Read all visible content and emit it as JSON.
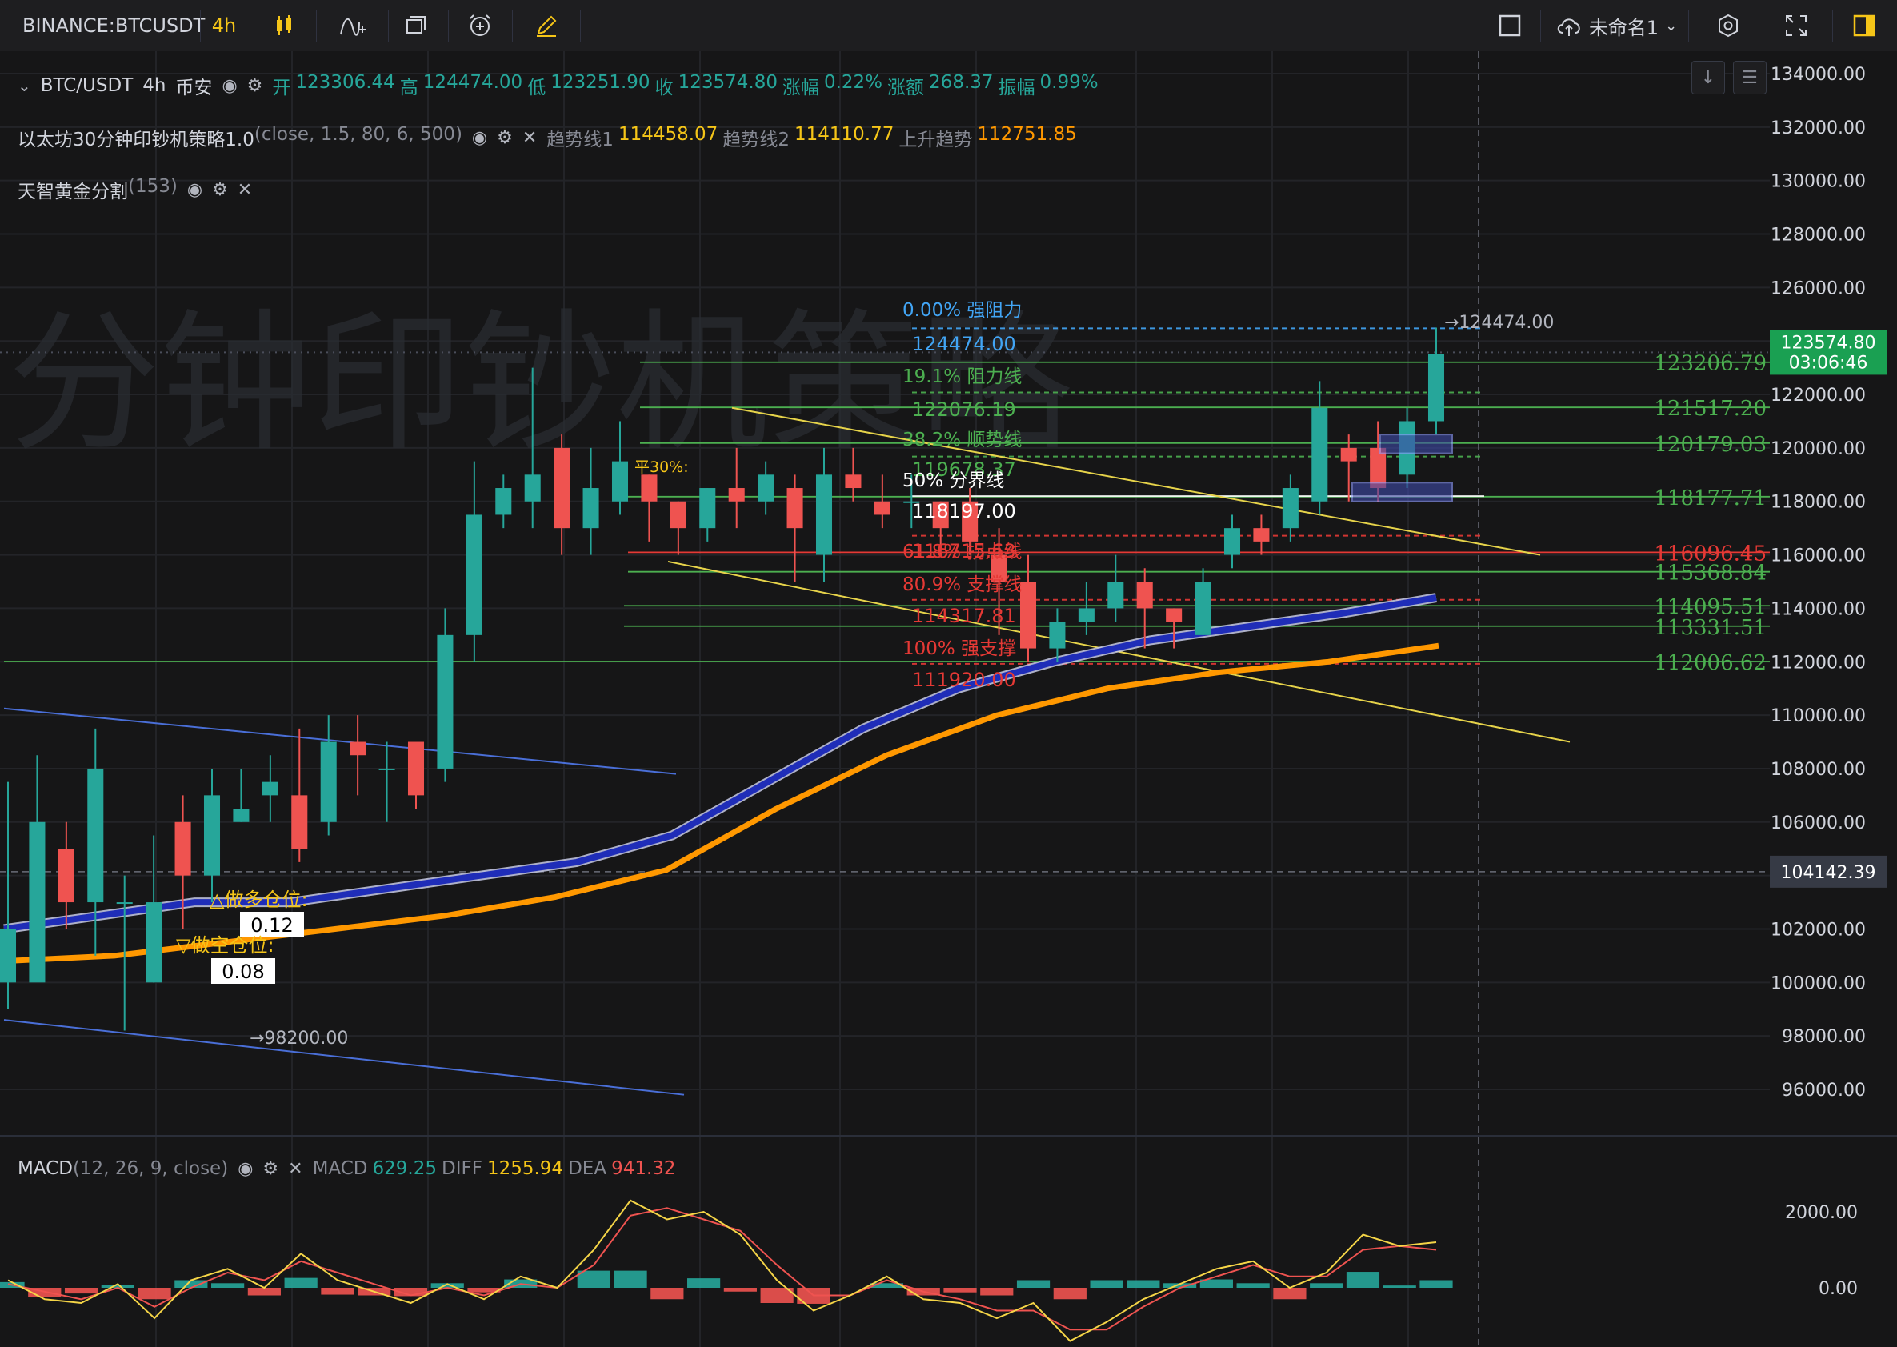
{
  "toolbar": {
    "symbol": "BINANCE:BTCUSDT",
    "interval": "4h",
    "layout_name": "未命名1"
  },
  "legend": {
    "main": {
      "pair": "BTC/USDT",
      "interval": "4h",
      "exchange": "币安",
      "open_label": "开",
      "open": "123306.44",
      "high_label": "高",
      "high": "124474.00",
      "low_label": "低",
      "low": "123251.90",
      "close_label": "收",
      "close": "123574.80",
      "change_pct_label": "涨幅",
      "change_pct": "0.22%",
      "change_amt_label": "涨额",
      "change_amt": "268.37",
      "amplitude_label": "振幅",
      "amplitude": "0.99%"
    },
    "strategy": {
      "name": "以太坊30分钟印钞机策略1.0",
      "params": "(close, 1.5, 80, 6, 500)",
      "t1_label": "趋势线1",
      "t1": "114458.07",
      "t2_label": "趋势线2",
      "t2": "114110.77",
      "up_label": "上升趋势",
      "up": "112751.85"
    },
    "golden": {
      "name": "天智黄金分割",
      "params": "(153)"
    },
    "macd": {
      "name": "MACD",
      "params": "(12, 26, 9, close)",
      "macd_label": "MACD",
      "macd": "629.25",
      "diff_label": "DIFF",
      "diff": "1255.94",
      "dea_label": "DEA",
      "dea": "941.32"
    }
  },
  "watermark": "分钟印钞机策略",
  "colors": {
    "up": "#26a69a",
    "down": "#ef5350",
    "blue_ma": "#1f2db8",
    "orange_ma": "#ff9800",
    "trend_yellow": "#e6d34a",
    "fib_green": "#4caf50",
    "fib_red": "#e53935",
    "fib_blue": "#42a5f5"
  },
  "chart_data": {
    "type": "candlestick",
    "symbol": "BINANCE:BTCUSDT",
    "interval": "4h",
    "ylim": [
      94000,
      135000
    ],
    "y_ticks": [
      134000,
      132000,
      130000,
      128000,
      126000,
      124000,
      122000,
      120000,
      118000,
      116000,
      114000,
      112000,
      110000,
      108000,
      106000,
      104000,
      102000,
      100000,
      98000,
      96000
    ],
    "last_price": "123574.80",
    "countdown": "03:06:46",
    "crosshair_price": "104142.39",
    "high_marker": "→124474.00",
    "low_marker": "→98200.00",
    "right_levels": [
      {
        "label": "123206.79",
        "value": 123206.79,
        "color": "#4caf50"
      },
      {
        "label": "121517.20",
        "value": 121517.2,
        "color": "#4caf50"
      },
      {
        "label": "120179.03",
        "value": 120179.03,
        "color": "#4caf50"
      },
      {
        "label": "118177.71",
        "value": 118177.71,
        "color": "#4caf50"
      },
      {
        "label": "116096.45",
        "value": 116096.45,
        "color": "#e53935"
      },
      {
        "label": "115368.84",
        "value": 115368.84,
        "color": "#4caf50"
      },
      {
        "label": "114095.51",
        "value": 114095.51,
        "color": "#4caf50"
      },
      {
        "label": "113331.51",
        "value": 113331.51,
        "color": "#4caf50"
      },
      {
        "label": "112006.62",
        "value": 112006.62,
        "color": "#4caf50"
      }
    ],
    "fib_levels": [
      {
        "pct": "0.00% 强阻力",
        "price": "124474.00",
        "value": 124474,
        "color": "#42a5f5"
      },
      {
        "pct": "19.1% 阻力线",
        "price": "122076.19",
        "value": 122076.19,
        "color": "#4caf50"
      },
      {
        "pct": "38.2% 顺势线",
        "price": "119678.37",
        "value": 119678.37,
        "color": "#4caf50"
      },
      {
        "pct": "50% 分界线",
        "price": "118197.00",
        "value": 118197,
        "color": "#ffffff"
      },
      {
        "pct": "61.8% 拐点线",
        "price": "116715.63",
        "value": 116715.63,
        "color": "#e53935"
      },
      {
        "pct": "80.9% 支撑线",
        "price": "114317.81",
        "value": 114317.81,
        "color": "#e53935"
      },
      {
        "pct": "100% 强支撑",
        "price": "111920.00",
        "value": 111920,
        "color": "#e53935"
      }
    ],
    "annotations": [
      {
        "text": "平30%:",
        "color": "#f5c518"
      },
      {
        "text": "△做多仓位:",
        "color": "#f5c518"
      },
      {
        "text": "0.12",
        "color": "#000000"
      },
      {
        "text": "▽做空仓位:",
        "color": "#f5c518"
      },
      {
        "text": "0.08",
        "color": "#000000"
      }
    ],
    "candles_approx": [
      [
        100,
        102,
        107.5,
        99
      ],
      [
        100,
        106,
        108.5,
        102
      ],
      [
        105,
        103,
        106,
        102
      ],
      [
        103,
        108,
        109.5,
        101
      ],
      [
        103,
        103,
        104,
        98.2
      ],
      [
        100,
        103,
        105.5,
        100
      ],
      [
        106,
        104,
        107,
        102
      ],
      [
        104,
        107,
        108,
        103
      ],
      [
        106,
        106.5,
        108,
        106
      ],
      [
        107,
        107.5,
        108.5,
        106
      ],
      [
        107,
        105,
        109.5,
        104.5
      ],
      [
        106,
        109,
        110,
        105.5
      ],
      [
        109,
        108.5,
        110,
        107
      ],
      [
        108,
        108,
        109,
        106
      ],
      [
        109,
        107,
        108.5,
        106.5
      ],
      [
        108,
        113,
        114,
        107.5
      ],
      [
        113,
        117.5,
        119.5,
        112
      ],
      [
        117.5,
        118.5,
        119,
        117
      ],
      [
        118,
        119,
        123,
        117
      ],
      [
        120,
        117,
        120.5,
        116
      ],
      [
        117,
        118.5,
        120,
        116
      ],
      [
        118,
        119.5,
        121,
        117.5
      ],
      [
        119,
        118,
        119,
        116.5
      ],
      [
        118,
        117,
        118,
        116
      ],
      [
        117,
        118.5,
        118.5,
        116.5
      ],
      [
        118.5,
        118,
        120,
        117
      ],
      [
        118,
        119,
        119.5,
        117.5
      ],
      [
        118.5,
        117,
        119,
        115
      ],
      [
        116,
        119,
        120,
        115
      ],
      [
        119,
        118.5,
        120,
        118
      ],
      [
        118,
        117.5,
        119,
        117
      ],
      [
        118,
        118,
        119,
        117
      ],
      [
        118,
        117,
        118,
        116
      ],
      [
        118,
        116.5,
        118.5,
        116
      ],
      [
        116,
        115,
        117,
        113
      ],
      [
        115,
        112.5,
        116,
        112
      ],
      [
        112.5,
        113.5,
        114,
        112
      ],
      [
        113.5,
        114,
        115,
        113
      ],
      [
        114,
        115,
        116,
        113.5
      ],
      [
        115,
        114,
        115.5,
        112.5
      ],
      [
        114,
        113.5,
        114,
        112.5
      ],
      [
        113,
        115,
        115.5,
        113
      ],
      [
        116,
        117,
        117.5,
        115.5
      ],
      [
        117,
        116.5,
        117.5,
        116
      ],
      [
        117,
        118.5,
        119,
        116.5
      ],
      [
        118,
        121.5,
        122.5,
        117.5
      ],
      [
        120,
        119.5,
        120.5,
        118
      ],
      [
        120,
        118.5,
        121,
        118
      ],
      [
        119,
        121,
        121.5,
        118.5
      ],
      [
        121,
        123.5,
        124.5,
        120.5
      ]
    ],
    "ma_blue": [
      102,
      102.5,
      103,
      103,
      103.5,
      104,
      104.5,
      105.5,
      107.5,
      109.5,
      111,
      112,
      112.8,
      113.3,
      113.8,
      114.4
    ],
    "ma_orange": [
      100.8,
      101,
      101.5,
      102,
      102.5,
      103.2,
      104.2,
      106.5,
      108.5,
      110,
      111,
      111.6,
      112,
      112.6
    ],
    "macd": {
      "ylim": [
        -1600,
        2800
      ],
      "y_ticks": [
        2000,
        0
      ],
      "diff": [
        200,
        -300,
        -400,
        100,
        -800,
        200,
        500,
        0,
        900,
        200,
        -100,
        -400,
        100,
        -300,
        300,
        0,
        1000,
        2300,
        1800,
        2000,
        1400,
        200,
        -600,
        -200,
        300,
        -300,
        -400,
        -800,
        -400,
        -1400,
        -900,
        -300,
        100,
        500,
        700,
        0,
        400,
        1400,
        1100,
        1200
      ],
      "dea": [
        100,
        -100,
        -300,
        0,
        -500,
        0,
        400,
        200,
        700,
        400,
        100,
        -200,
        0,
        -200,
        100,
        0,
        600,
        1900,
        2100,
        1800,
        1500,
        600,
        -200,
        -200,
        200,
        -100,
        -300,
        -600,
        -600,
        -1100,
        -1100,
        -500,
        0,
        300,
        600,
        300,
        300,
        1000,
        1100,
        1000
      ],
      "hist": [
        150,
        -250,
        -150,
        80,
        -300,
        200,
        120,
        -200,
        260,
        -180,
        -200,
        -220,
        120,
        -120,
        220,
        0,
        450,
        450,
        -300,
        250,
        -100,
        -400,
        -420,
        0,
        120,
        -200,
        -120,
        -200,
        200,
        -300,
        200,
        200,
        120,
        220,
        120,
        -300,
        120,
        420,
        60,
        200
      ]
    }
  }
}
